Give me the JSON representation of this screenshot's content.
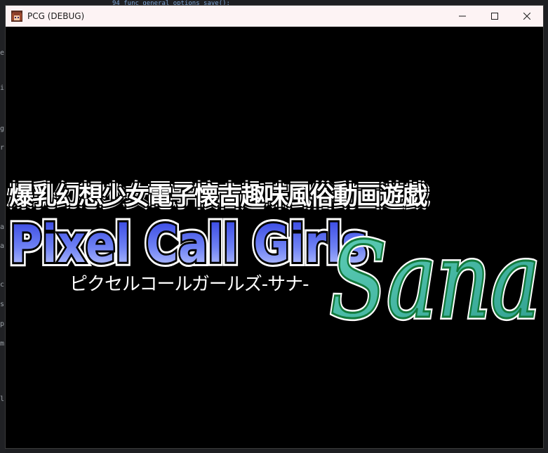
{
  "window": {
    "title": "PCG (DEBUG)",
    "controls": {
      "minimize_icon": "minimize-icon",
      "maximize_icon": "maximize-icon",
      "close_icon": "close-icon"
    }
  },
  "background_editor": {
    "code_snippet": "94   func general_options_save():"
  },
  "game": {
    "subtitle_kanji": "爆乳幻想少女電子懐古趣味風俗動画遊戯",
    "logo_main": "Pixel Call Girls",
    "logo_script": "Sana",
    "subtitle_katakana": "ピクセルコールガールズ-サナ-"
  },
  "colors": {
    "titlebar_bg": "#fdf3f4",
    "game_bg": "#000000",
    "logo_blue": "#4a5ae8",
    "logo_light_blue": "#a9b6ff",
    "script_green": "#1f9e4a",
    "script_teal": "#6cc7b0"
  }
}
